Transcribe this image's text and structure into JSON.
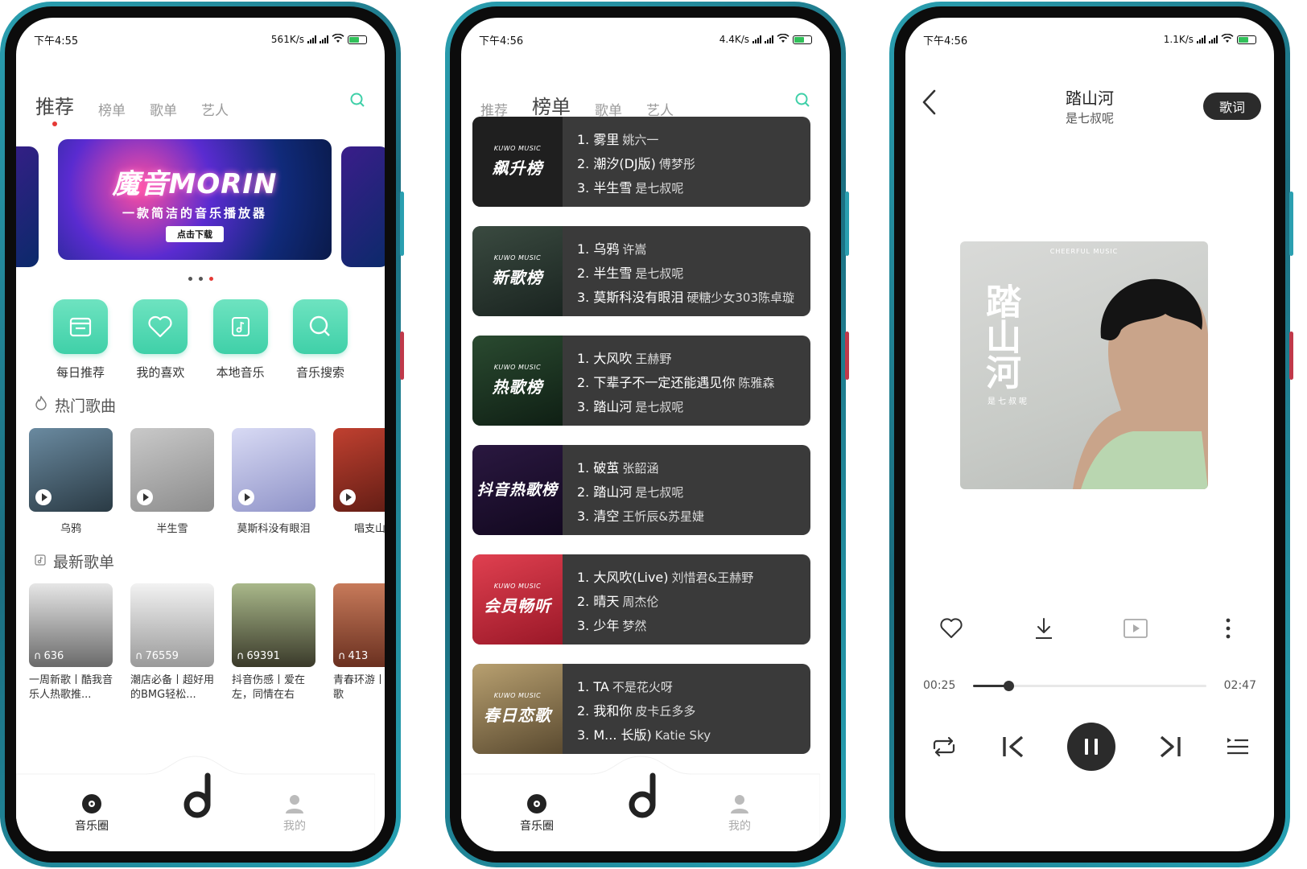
{
  "colors": {
    "accent_green": "#3fd0a8",
    "frame": "#1f8a9c",
    "dark": "#2b2b2b",
    "red_dot": "#e53935",
    "yellow_dot": "#f5b400"
  },
  "phone1": {
    "status": {
      "time": "下午4:55",
      "speed": "561K/s"
    },
    "tabs": [
      "推荐",
      "榜单",
      "歌单",
      "艺人"
    ],
    "banner": {
      "title": "魔音MORIN",
      "subtitle": "一款简洁的音乐播放器",
      "button": "点击下载"
    },
    "quick": [
      {
        "label": "每日推荐",
        "icon": "calendar-icon"
      },
      {
        "label": "我的喜欢",
        "icon": "heart-icon"
      },
      {
        "label": "本地音乐",
        "icon": "music-note-icon"
      },
      {
        "label": "音乐搜索",
        "icon": "search-icon"
      }
    ],
    "hot_title": "热门歌曲",
    "hot_songs": [
      {
        "name": "乌鸦",
        "color": "#3d5a6a"
      },
      {
        "name": "半生雪",
        "color": "#9a9a9a"
      },
      {
        "name": "莫斯科没有眼泪",
        "color": "#b7b9e0"
      },
      {
        "name": "唱支山歌",
        "color": "#a53020"
      }
    ],
    "new_title": "最新歌单",
    "playlists": [
      {
        "count": "636",
        "name": "一周新歌丨酷我音乐人热歌推...",
        "color": "#cfcfcf"
      },
      {
        "count": "76559",
        "name": "潮店必备丨超好用的BMG轻松...",
        "color": "#e8e8e8"
      },
      {
        "count": "69391",
        "name": "抖音伤感丨爱在左，同情在右",
        "color": "#8a9a6a"
      },
      {
        "count": "413",
        "name": "青春环游丨过这些歌",
        "color": "#b76040"
      }
    ],
    "nav": {
      "left": "音乐圈",
      "right": "我的"
    }
  },
  "phone2": {
    "status": {
      "time": "下午4:56",
      "speed": "4.4K/s"
    },
    "tabs": [
      "推荐",
      "榜单",
      "歌单",
      "艺人"
    ],
    "kuwo": "KUWO MUSIC",
    "charts": [
      {
        "name": "飙升榜",
        "bg": "#2a2a2a",
        "songs": [
          {
            "t": "1. 雾里",
            "a": "姚六一"
          },
          {
            "t": "2. 潮汐(DJ版)",
            "a": "傅梦彤"
          },
          {
            "t": "3. 半生雪",
            "a": "是七叔呢"
          }
        ]
      },
      {
        "name": "新歌榜",
        "bg": "#2f3a34",
        "songs": [
          {
            "t": "1. 乌鸦",
            "a": "许嵩"
          },
          {
            "t": "2. 半生雪",
            "a": "是七叔呢"
          },
          {
            "t": "3. 莫斯科没有眼泪",
            "a": "硬糖少女303陈卓璇"
          }
        ]
      },
      {
        "name": "热歌榜",
        "bg": "#1f2f26",
        "songs": [
          {
            "t": "1. 大风吹",
            "a": "王赫野"
          },
          {
            "t": "2. 下辈子不一定还能遇见你",
            "a": "陈雅森"
          },
          {
            "t": "3. 踏山河",
            "a": "是七叔呢"
          }
        ]
      },
      {
        "name": "抖音热歌榜",
        "bg": "#1a1030",
        "songs": [
          {
            "t": "1. 破茧",
            "a": "张韶涵"
          },
          {
            "t": "2. 踏山河",
            "a": "是七叔呢"
          },
          {
            "t": "3. 清空",
            "a": "王忻辰&苏星婕"
          }
        ]
      },
      {
        "name": "会员畅听",
        "bg": "#c8283a",
        "songs": [
          {
            "t": "1. 大风吹(Live)",
            "a": "刘惜君&王赫野"
          },
          {
            "t": "2. 晴天",
            "a": "周杰伦"
          },
          {
            "t": "3. 少年",
            "a": "梦然"
          }
        ]
      },
      {
        "name": "春日恋歌",
        "bg": "#6a5a40",
        "songs": [
          {
            "t": "1. TA",
            "a": "不是花火呀"
          },
          {
            "t": "2. 我和你",
            "a": "皮卡丘多多"
          },
          {
            "t": "3. M... 长版)",
            "a": "Katie Sky"
          }
        ]
      }
    ],
    "nav": {
      "left": "音乐圈",
      "right": "我的"
    }
  },
  "phone3": {
    "status": {
      "time": "下午4:56",
      "speed": "1.1K/s"
    },
    "title": "踏山河",
    "artist": "是七叔呢",
    "lyrics_button": "歌词",
    "album": {
      "tag": "CHEERFUL MUSIC",
      "title": "踏山河",
      "sign": "是七叔呢"
    },
    "time_current": "00:25",
    "time_total": "02:47",
    "progress": 0.15
  }
}
